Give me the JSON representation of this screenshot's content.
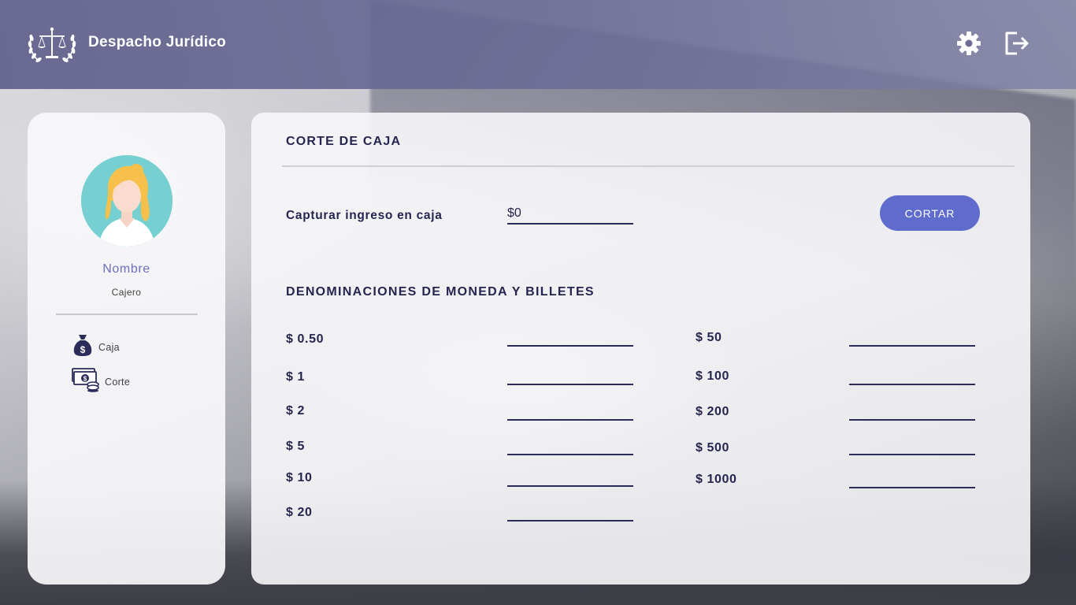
{
  "header": {
    "brand": "Despacho Jurídico",
    "icons": {
      "logo": "scales-laurel-logo",
      "settings": "gear-icon",
      "logout": "logout-icon"
    }
  },
  "sidebar": {
    "user_name": "Nombre",
    "user_role": "Cajero",
    "items": [
      {
        "label": "Caja",
        "icon": "money-bag-icon"
      },
      {
        "label": "Corte",
        "icon": "cash-coins-icon"
      }
    ]
  },
  "main": {
    "title": "CORTE DE CAJA",
    "capture_label": "Capturar ingreso en caja",
    "capture_value": "$0",
    "cut_button": "CORTAR",
    "denominations_title": "DENOMINACIONES DE MONEDA Y BILLETES",
    "denominations_left": [
      "$ 0.50",
      "$ 1",
      "$ 2",
      "$ 5",
      "$ 10",
      "$ 20"
    ],
    "denominations_right": [
      "$ 50",
      "$ 100",
      "$ 200",
      "$ 500",
      "$ 1000"
    ]
  },
  "colors": {
    "header_bg": "#6c6c96",
    "accent": "#5f6ccd",
    "text_dark": "#252550",
    "name_color": "#6c6fbf",
    "avatar_bg": "#76cfd0"
  }
}
